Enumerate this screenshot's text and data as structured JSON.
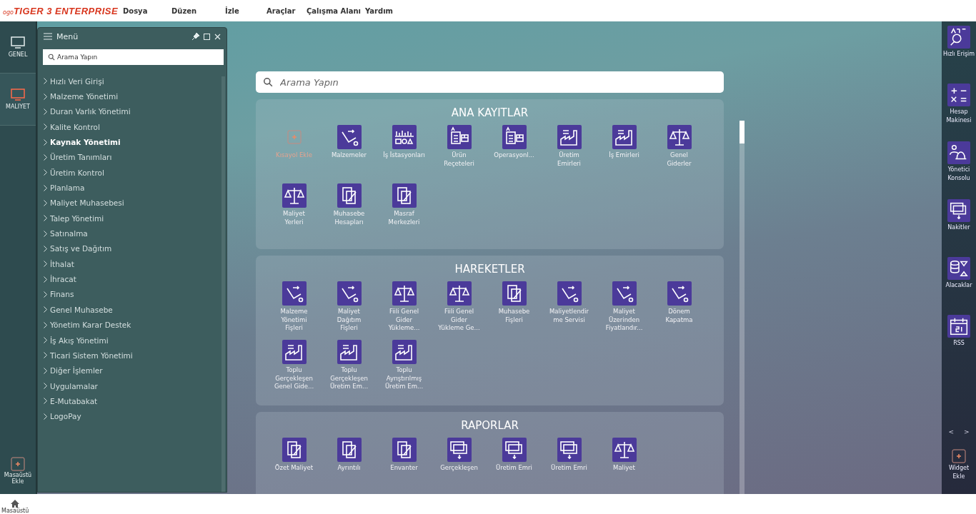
{
  "app": {
    "logo_prefix": "ogo",
    "logo": "TIGER 3 ENTERPRISE"
  },
  "menubar": [
    "Dosya",
    "Düzen",
    "İzle",
    "Araçlar",
    "Çalışma Alanı",
    "Yardım"
  ],
  "left_rail": [
    {
      "label": "GENEL",
      "selected": false
    },
    {
      "label": "MALIYET",
      "selected": true
    }
  ],
  "left_rail_bottom": {
    "label": "Masaüstü\nEkle"
  },
  "menu_panel": {
    "title": "Menü",
    "search": {
      "placeholder": "Arama Yapın"
    },
    "items": [
      {
        "label": "Hızlı Veri Girişi",
        "selected": false
      },
      {
        "label": "Malzeme Yönetimi",
        "selected": false
      },
      {
        "label": "Duran Varlık Yönetimi",
        "selected": false
      },
      {
        "label": "Kalite Kontrol",
        "selected": false
      },
      {
        "label": "Kaynak Yönetimi",
        "selected": true
      },
      {
        "label": "Üretim Tanımları",
        "selected": false
      },
      {
        "label": "Üretim Kontrol",
        "selected": false
      },
      {
        "label": "Planlama",
        "selected": false
      },
      {
        "label": "Maliyet Muhasebesi",
        "selected": false
      },
      {
        "label": "Talep Yönetimi",
        "selected": false
      },
      {
        "label": "Satınalma",
        "selected": false
      },
      {
        "label": "Satış ve Dağıtım",
        "selected": false
      },
      {
        "label": "İthalat",
        "selected": false
      },
      {
        "label": "İhracat",
        "selected": false
      },
      {
        "label": "Finans",
        "selected": false
      },
      {
        "label": "Genel Muhasebe",
        "selected": false
      },
      {
        "label": "Yönetim Karar Destek",
        "selected": false
      },
      {
        "label": "İş Akış Yönetimi",
        "selected": false
      },
      {
        "label": "Ticari Sistem Yönetimi",
        "selected": false
      },
      {
        "label": "Diğer İşlemler",
        "selected": false
      },
      {
        "label": "Uygulamalar",
        "selected": false
      },
      {
        "label": "E-Mutabakat",
        "selected": false
      },
      {
        "label": "LogoPay",
        "selected": false
      }
    ]
  },
  "main_search": {
    "placeholder": "Arama Yapın"
  },
  "sections": [
    {
      "title": "ANA KAYITLAR",
      "tiles": [
        {
          "kind": "add",
          "label": "Kısayol Ekle"
        },
        {
          "kind": "trolley",
          "label": "Malzemeler"
        },
        {
          "kind": "station",
          "label": "İş İstasyonları"
        },
        {
          "kind": "document",
          "label": "Ürün\nReçeteleri"
        },
        {
          "kind": "document",
          "label": "Operasyonl..."
        },
        {
          "kind": "factory",
          "label": "Üretim\nEmirleri"
        },
        {
          "kind": "factory",
          "label": "İş Emirleri"
        },
        {
          "kind": "scale",
          "label": "Genel\nGiderler"
        },
        {
          "kind": "scale",
          "label": "Maliyet\nYerleri"
        },
        {
          "kind": "form",
          "label": "Muhasebe\nHesapları"
        },
        {
          "kind": "form",
          "label": "Masraf\nMerkezleri"
        }
      ]
    },
    {
      "title": "HAREKETLER",
      "tiles": [
        {
          "kind": "trolley",
          "label": "Malzeme\nYönetimi\nFişleri"
        },
        {
          "kind": "trolley",
          "label": "Maliyet\nDağıtım\nFişleri"
        },
        {
          "kind": "scale",
          "label": "Fiili Genel\nGider\nYükleme..."
        },
        {
          "kind": "scale",
          "label": "Fiili Genel\nGider\nYükleme Ge..."
        },
        {
          "kind": "form",
          "label": "Muhasebe\nFişleri"
        },
        {
          "kind": "trolley",
          "label": "Maliyetlendir\nme Servisi"
        },
        {
          "kind": "trolley",
          "label": "Maliyet\nÜzerinden\nFiyatlandır..."
        },
        {
          "kind": "trolley",
          "label": "Dönem\nKapatma"
        },
        {
          "kind": "factory",
          "label": "Toplu\nGerçekleşen\nGenel Gide..."
        },
        {
          "kind": "factory",
          "label": "Toplu\nGerçekleşen\nÜretim Em..."
        },
        {
          "kind": "factory",
          "label": "Toplu\nAyrıştırılmış\nÜretim Em..."
        }
      ]
    },
    {
      "title": "RAPORLAR",
      "tiles": [
        {
          "kind": "form",
          "label": "Özet Maliyet"
        },
        {
          "kind": "form",
          "label": "Ayrıntılı"
        },
        {
          "kind": "form",
          "label": "Envanter"
        },
        {
          "kind": "stack",
          "label": "Gerçekleşen"
        },
        {
          "kind": "stack",
          "label": "Üretim Emri"
        },
        {
          "kind": "stack",
          "label": "Üretim Emri"
        },
        {
          "kind": "scale",
          "label": "Maliyet"
        }
      ]
    }
  ],
  "right_rail": [
    {
      "kind": "search",
      "label": "Hızlı Erişim"
    },
    {
      "kind": "calc",
      "label": "Hesap\nMakinesi"
    },
    {
      "kind": "console",
      "label": "Yönetici\nKonsolu"
    },
    {
      "kind": "stack",
      "label": "Nakitler"
    },
    {
      "kind": "coins",
      "label": "Alacaklar"
    },
    {
      "kind": "calendar",
      "label": "RSS"
    }
  ],
  "right_rail_bottom": {
    "prev": "<",
    "next": ">",
    "add_label": "Widget\nEkle"
  },
  "taskbar": {
    "label": "Masaüstü"
  }
}
